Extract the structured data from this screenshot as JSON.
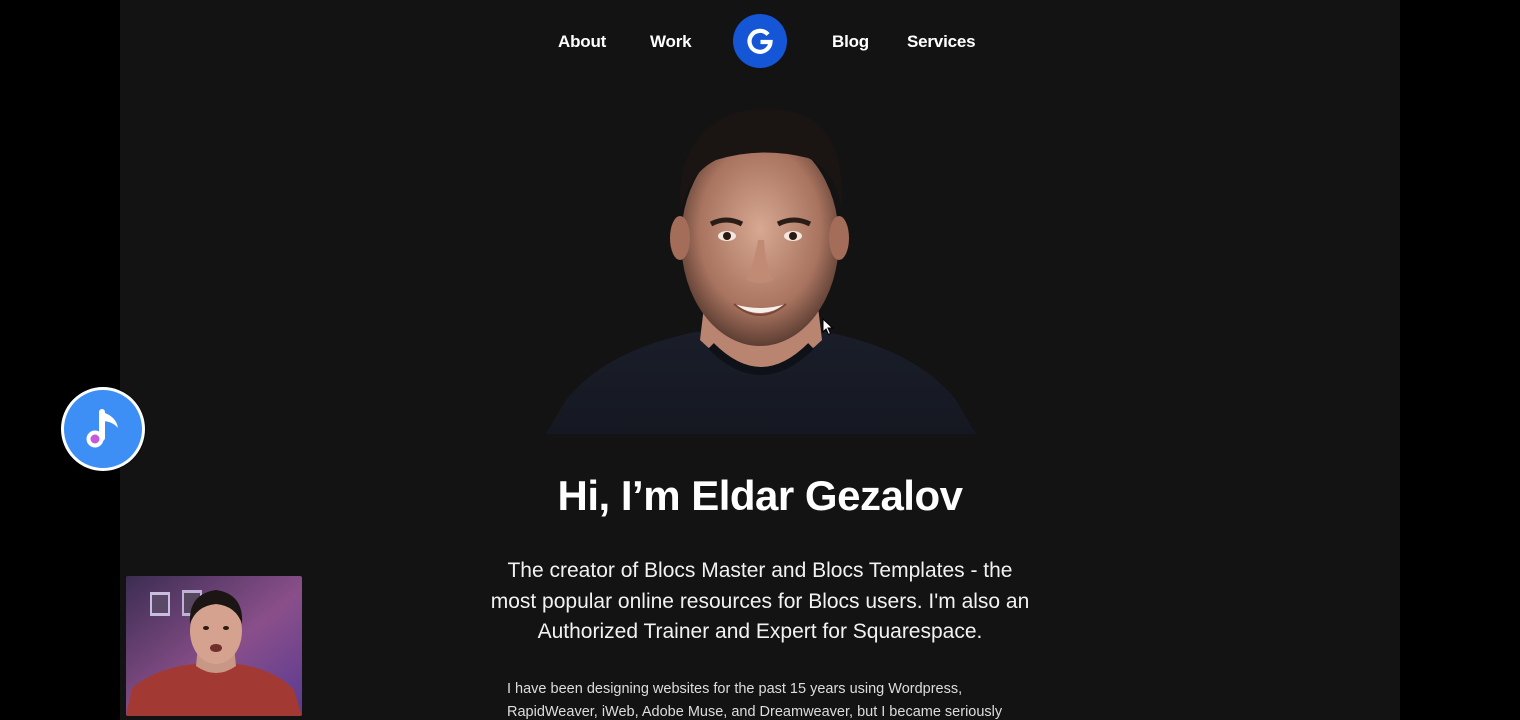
{
  "nav": {
    "items": [
      {
        "label": "About"
      },
      {
        "label": "Work"
      },
      {
        "label": "Blog"
      },
      {
        "label": "Services"
      }
    ],
    "logo_letter": "G",
    "logo_color": "#1456d6"
  },
  "hero": {
    "title": "Hi, I’m Eldar Gezalov",
    "subtitle": "The creator of Blocs Master and Blocs Templates - the most popular online resources for Blocs users. I'm also an Authorized Trainer and Expert for Squarespace.",
    "body": "I have been designing websites for the past 15 years using Wordpress, RapidWeaver, iWeb, Adobe Muse, and Dreamweaver, but I became seriously"
  },
  "overlay": {
    "music_icon": "music-note-icon",
    "music_color": "#3d8ef5"
  },
  "colors": {
    "page_bg": "#131314",
    "outer_bg": "#000000",
    "text": "#ffffff"
  }
}
